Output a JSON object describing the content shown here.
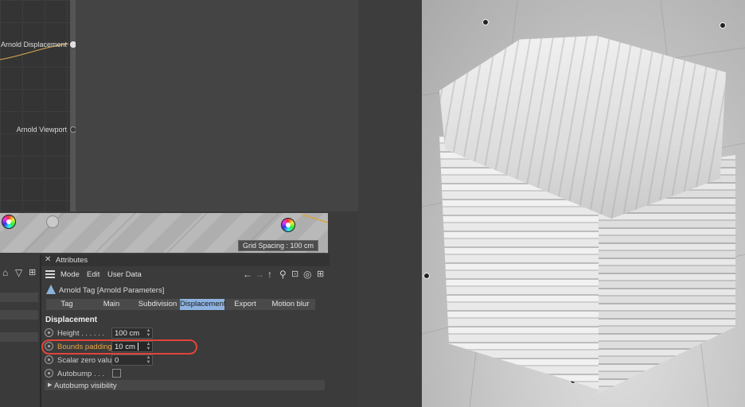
{
  "node_editor": {
    "ports": [
      {
        "label": "Arnold Displacement",
        "connected": true
      },
      {
        "label": "Arnold Viewport",
        "connected": false
      }
    ]
  },
  "viewport": {
    "grid_spacing": "Grid Spacing : 100 cm",
    "icons": [
      "color-wheel-icon",
      "color-wheel-icon"
    ]
  },
  "object_manager": {
    "icons": [
      "home-icon",
      "filter-icon",
      "new-window-icon"
    ]
  },
  "attributes": {
    "close_icon": "close-icon",
    "title": "Attributes",
    "menu": [
      "Mode",
      "Edit",
      "User Data"
    ],
    "toolbar_icons": [
      "back-arrow-icon",
      "forward-arrow-icon",
      "up-arrow-icon",
      "search-icon",
      "lock-icon",
      "target-icon",
      "new-window-icon"
    ],
    "object_label": "Arnold Tag [Arnold Parameters]",
    "tabs": [
      "Tag",
      "Main",
      "Subdivision",
      "Displacement",
      "Export",
      "Motion blur"
    ],
    "active_tab": "Displacement",
    "section_title": "Displacement",
    "params": [
      {
        "label": "Height . . . . . .",
        "value": "100 cm",
        "type": "number"
      },
      {
        "label": "Bounds padding",
        "value": "10 cm",
        "type": "number",
        "highlighted": true
      },
      {
        "label": "Scalar zero value",
        "value": "0",
        "type": "number"
      },
      {
        "label": "Autobump . . .",
        "checked": false,
        "type": "checkbox"
      }
    ],
    "collapsed_group": "Autobump visibility"
  },
  "colors": {
    "accent_tab": "#8fb3e0",
    "highlight_label": "#e6a54a",
    "annotation_oval": "#e0453a"
  }
}
